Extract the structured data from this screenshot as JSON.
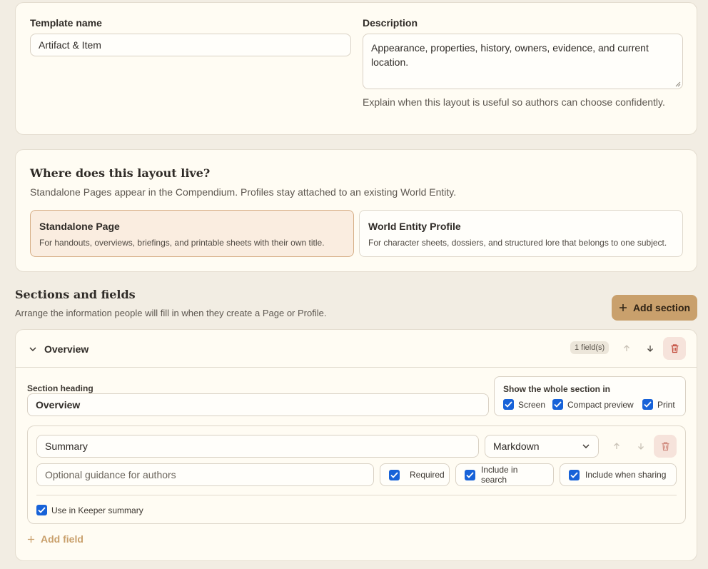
{
  "template": {
    "name_label": "Template name",
    "name_value": "Artifact & Item",
    "description_label": "Description",
    "description_value": "Appearance, properties, history, owners, evidence, and current location.",
    "description_hint": "Explain when this layout is useful so authors can choose confidently."
  },
  "layout": {
    "heading": "Where does this layout live?",
    "subtext": "Standalone Pages appear in the Compendium. Profiles stay attached to an existing World Entity.",
    "options": [
      {
        "title": "Standalone Page",
        "desc": "For handouts, overviews, briefings, and printable sheets with their own title.",
        "selected": true
      },
      {
        "title": "World Entity Profile",
        "desc": "For character sheets, dossiers, and structured lore that belongs to one subject.",
        "selected": false
      }
    ]
  },
  "sections": {
    "heading": "Sections and fields",
    "subtext": "Arrange the information people will fill in when they create a Page or Profile.",
    "add_section_label": "Add section",
    "items": [
      {
        "title": "Overview",
        "field_count": "1 field(s)",
        "heading_label": "Section heading",
        "heading_value": "Overview",
        "show_in_label": "Show the whole section in",
        "show_in": [
          {
            "label": "Screen",
            "checked": true
          },
          {
            "label": "Compact preview",
            "checked": true
          },
          {
            "label": "Print",
            "checked": true
          }
        ],
        "fields": [
          {
            "name_value": "Summary",
            "type_value": "Markdown",
            "guidance_placeholder": "Optional guidance for authors",
            "required_label": "Required",
            "include_search_label": "Include in search",
            "include_sharing_label": "Include when sharing",
            "keeper_summary_label": "Use in Keeper summary"
          }
        ],
        "add_field_label": "Add field"
      }
    ]
  },
  "colors": {
    "accent": "#c9a06c",
    "checkbox": "#1762d8",
    "danger_bg": "#f6e3db",
    "background": "#f2ede3"
  }
}
